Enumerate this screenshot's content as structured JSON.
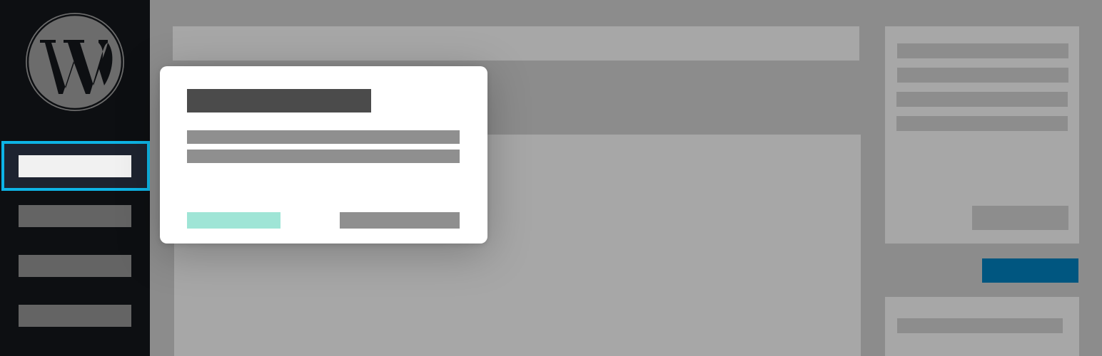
{
  "app": {
    "logo_icon": "wordpress-logo-icon"
  },
  "colors": {
    "sidebar_bg": "#0d0f12",
    "focus_ring": "#0db4e6",
    "primary_action": "#005680",
    "modal_accent": "#9fe5d6"
  },
  "sidebar": {
    "items": [
      {
        "label": "",
        "active": true
      },
      {
        "label": "",
        "active": false
      },
      {
        "label": "",
        "active": false
      },
      {
        "label": "",
        "active": false
      }
    ]
  },
  "modal": {
    "title": "",
    "body_lines": [
      "",
      ""
    ],
    "primary_label": "",
    "secondary_label": ""
  },
  "editor": {
    "title": ""
  },
  "settings_panel": {
    "lines": [
      "",
      "",
      "",
      ""
    ],
    "button_label": "",
    "publish_label": ""
  }
}
